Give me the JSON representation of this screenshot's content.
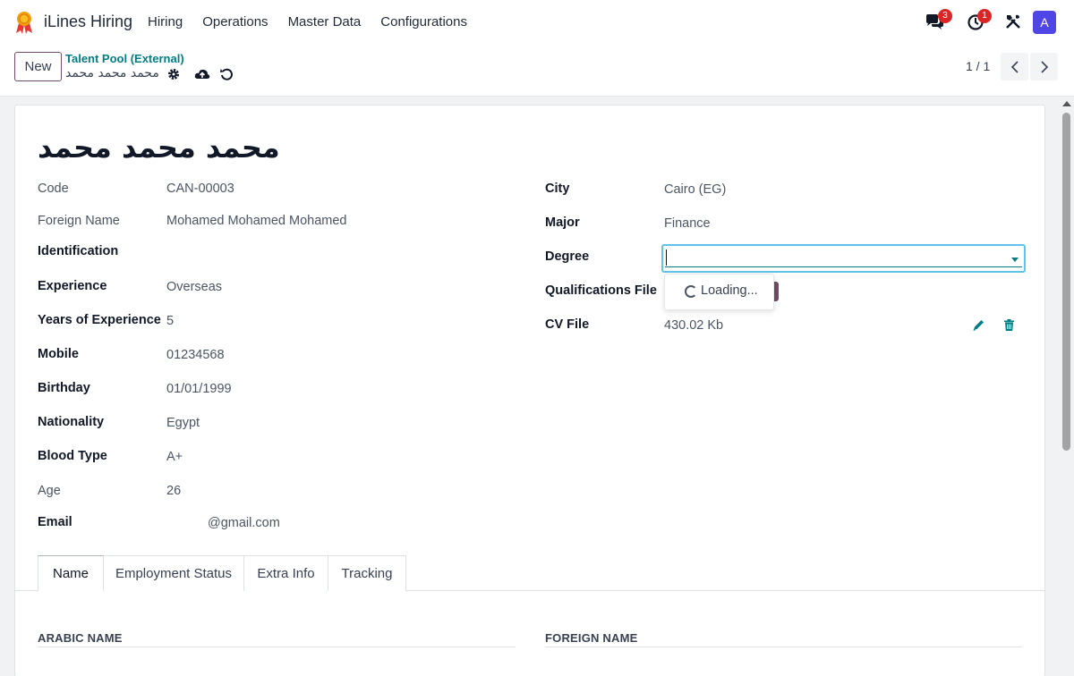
{
  "app": {
    "name": "iLines Hiring",
    "menu": [
      "Hiring",
      "Operations",
      "Master Data",
      "Configurations"
    ],
    "messages_badge": "3",
    "activities_badge": "1",
    "avatar_letter": "A",
    "accent_color": "#714b67",
    "link_color": "#017e84"
  },
  "control_panel": {
    "new_label": "New",
    "breadcrumb_parent": "Talent Pool (External)",
    "breadcrumb_current": "محمد محمد محمد",
    "pager": "1 / 1"
  },
  "record": {
    "title": "محمد محمد محمد",
    "left_fields": [
      {
        "label": "Code",
        "value": "CAN-00003"
      },
      {
        "label": "Foreign Name",
        "value": "Mohamed Mohamed Mohamed"
      },
      {
        "label": "Identification",
        "value": ""
      },
      {
        "label": "Experience",
        "value": "Overseas"
      },
      {
        "label": "Years of Experience",
        "value": "5"
      },
      {
        "label": "Mobile",
        "value": "01234568"
      },
      {
        "label": "Birthday",
        "value": "01/01/1999"
      },
      {
        "label": "Nationality",
        "value": "Egypt"
      },
      {
        "label": "Blood Type",
        "value": "A+"
      },
      {
        "label": "Age",
        "value": "26"
      },
      {
        "label": "Email",
        "value": "@gmail.com"
      }
    ],
    "right_fields": [
      {
        "label": "City",
        "value": "Cairo (EG)"
      },
      {
        "label": "Major",
        "value": "Finance"
      },
      {
        "label": "Degree",
        "value": ""
      },
      {
        "label": "Qualifications File",
        "value": ""
      },
      {
        "label": "CV File",
        "value": "430.02 Kb"
      }
    ],
    "dropdown_text": "Loading..."
  },
  "tabs": [
    "Name",
    "Employment Status",
    "Extra Info",
    "Tracking"
  ],
  "sections": {
    "arabic_name": "ARABIC NAME",
    "foreign_name": "FOREIGN NAME"
  }
}
